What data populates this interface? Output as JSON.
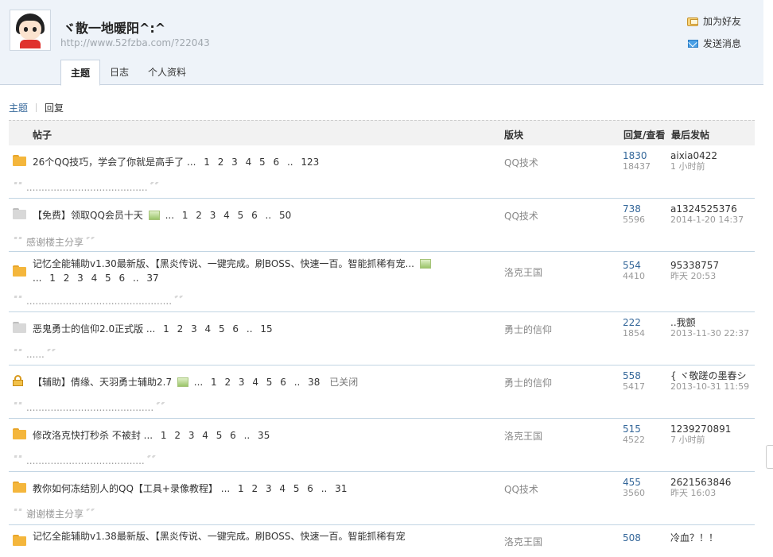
{
  "user": {
    "name": "ヾ散一地暖阳^:^",
    "url": "http://www.52fzba.com/?22043"
  },
  "actions": {
    "add_friend": "加为好友",
    "send_message": "发送消息"
  },
  "tabs": [
    "主题",
    "日志",
    "个人资料"
  ],
  "filter": {
    "topics": "主题",
    "replies": "回复"
  },
  "table_header": {
    "post": "帖子",
    "forum": "版块",
    "reply_view": "回复/查看",
    "last_post": "最后发帖"
  },
  "rows": [
    {
      "title": "26个QQ技巧，学会了你就是高手了",
      "pages": "... 1 2 3 4 5 6 .. 123",
      "forum": "QQ技术",
      "replies": "1830",
      "views": "18437",
      "last_author": "aixia0422",
      "last_time": "1 小时前",
      "quote": "........................................"
    },
    {
      "title": "【免费】领取QQ会员十天",
      "pages": "... 1 2 3 4 5 6 .. 50",
      "forum": "QQ技术",
      "replies": "738",
      "views": "5596",
      "last_author": "a1324525376",
      "last_time": "2014-1-20 14:37",
      "quote": "感谢楼主分享"
    },
    {
      "title": "记忆全能辅助v1.30最新版、【黑炎传说、一键完成。刷BOSS、快速一百。智能抓稀有宠...",
      "pages": "... 1 2 3 4 5 6 .. 37",
      "forum": "洛克王国",
      "replies": "554",
      "views": "4410",
      "last_author": "95338757",
      "last_time": "昨天 20:53",
      "quote": "................................................"
    },
    {
      "title": "恶鬼勇士的信仰2.0正式版",
      "pages": "... 1 2 3 4 5 6 .. 15",
      "forum": "勇士的信仰",
      "replies": "222",
      "views": "1854",
      "last_author": "..我颤",
      "last_time": "2013-11-30 22:37",
      "quote": "......"
    },
    {
      "title": "【辅助】倩缘、天羽勇士辅助2.7",
      "pages": "... 1 2 3 4 5 6 .. 38",
      "closed": "已关闭",
      "forum": "勇士的信仰",
      "replies": "558",
      "views": "5417",
      "last_author": "{ ヾ敬蹉の墨春シ",
      "last_time": "2013-10-31 11:59",
      "quote": ".........................................."
    },
    {
      "title": "修改洛克快打秒杀 不被封",
      "pages": "... 1 2 3 4 5 6 .. 35",
      "forum": "洛克王国",
      "replies": "515",
      "views": "4522",
      "last_author": "1239270891",
      "last_time": "7 小时前",
      "quote": "......................................."
    },
    {
      "title": "教你如何冻结别人的QQ【工具+录像教程】",
      "pages": "... 1 2 3 4 5 6 .. 31",
      "forum": "QQ技术",
      "replies": "455",
      "views": "3560",
      "last_author": "2621563846",
      "last_time": "昨天 16:03",
      "quote": "谢谢楼主分享"
    },
    {
      "title": "记忆全能辅助v1.38最新版、【黑炎传说、一键完成。刷BOSS、快速一百。智能抓稀有宠",
      "forum": "洛克王国",
      "replies": "508",
      "last_author": "冷血？！！"
    }
  ]
}
